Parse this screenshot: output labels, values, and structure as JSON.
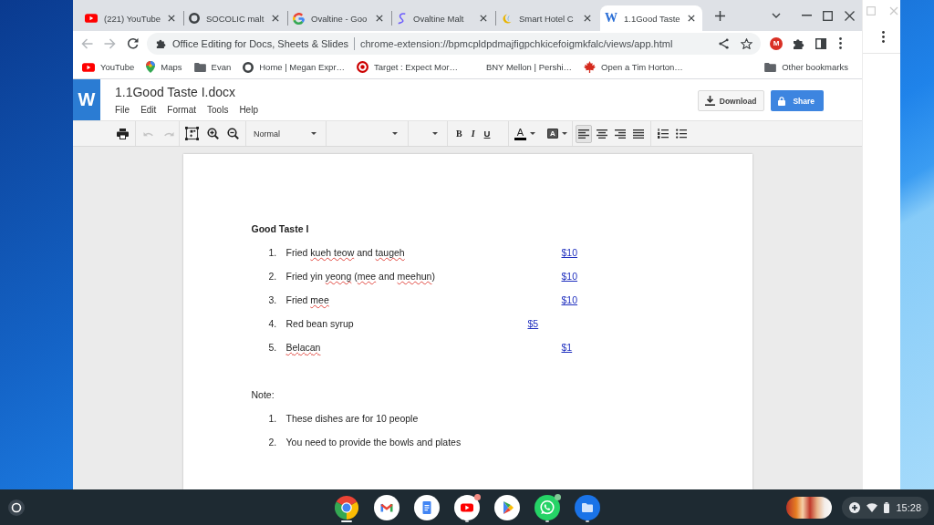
{
  "browser": {
    "tabs": [
      {
        "kind": "video",
        "title": "(221) YouTube",
        "selected": false
      },
      {
        "kind": "ring",
        "title": "SOCOLIC malt",
        "selected": false
      },
      {
        "kind": "g",
        "title": "Ovaltine - Goo",
        "selected": false
      },
      {
        "kind": "script",
        "title": "Ovaltine Malt",
        "selected": false
      },
      {
        "kind": "crescent",
        "title": "Smart Hotel C",
        "selected": false
      },
      {
        "kind": "letter",
        "letter": "W",
        "title": "1.1Good Taste",
        "selected": true
      }
    ],
    "navigation": [
      {
        "kind": "back",
        "disabled": true
      },
      {
        "kind": "forward",
        "disabled": true
      }
    ],
    "omnibox": {
      "site": "Office Editing for Docs, Sheets & Slides",
      "url": "chrome-extension://bpmcpldpdmajfigpchkicefoigmkfalc/views/app.html"
    },
    "extension_badge": "M",
    "bookmarks": [
      {
        "kind": "video",
        "label": "YouTube"
      },
      {
        "kind": "pin",
        "label": "Maps"
      },
      {
        "kind": "folder",
        "label": "Evan"
      },
      {
        "kind": "ring",
        "label": "Home | Megan Expr…"
      },
      {
        "kind": "target",
        "label": "Target : Expect Mor…"
      },
      {
        "kind": "blank",
        "label": "BNY Mellon | Pershi…"
      },
      {
        "kind": "leaf",
        "label": "Open a Tim Horton…"
      }
    ],
    "other_bookmarks": "Other bookmarks"
  },
  "app": {
    "logo": "W",
    "file_name": "1.1Good Taste I.docx",
    "menu": [
      "File",
      "Edit",
      "Format",
      "Tools",
      "Help"
    ],
    "download": "Download",
    "share": "Share",
    "toolbar": {
      "history": [
        {
          "kind": "undo",
          "disabled": true
        },
        {
          "kind": "redo",
          "disabled": true
        }
      ],
      "style": "Normal",
      "format": [
        {
          "kind": "bold",
          "label": "B"
        },
        {
          "kind": "italic",
          "label": "I"
        },
        {
          "kind": "underline",
          "label": "U"
        }
      ],
      "text_color": {
        "label": "A",
        "color": "#000000"
      },
      "highlight": {
        "label": "A"
      },
      "alignment": [
        {
          "kind": "left",
          "selected": true
        },
        {
          "kind": "center",
          "selected": false
        },
        {
          "kind": "right",
          "selected": false
        },
        {
          "kind": "justify",
          "selected": false
        }
      ]
    },
    "document": {
      "title": "Good Taste I",
      "items": [
        {
          "kind": "far",
          "number": "1.",
          "parts": [
            {
              "text": "Fried ",
              "misspelled": false
            },
            {
              "text": "kueh teow",
              "misspelled": true
            },
            {
              "text": " and ",
              "misspelled": false
            },
            {
              "text": "taugeh",
              "misspelled": true
            }
          ],
          "price": "$10"
        },
        {
          "kind": "far",
          "number": "2.",
          "parts": [
            {
              "text": "Fried yin ",
              "misspelled": false
            },
            {
              "text": "yeong",
              "misspelled": true
            },
            {
              "text": " (",
              "misspelled": false
            },
            {
              "text": "mee",
              "misspelled": true
            },
            {
              "text": " and ",
              "misspelled": false
            },
            {
              "text": "meehun",
              "misspelled": true
            },
            {
              "text": ")",
              "misspelled": false
            }
          ],
          "price": "$10"
        },
        {
          "kind": "far",
          "number": "3.",
          "parts": [
            {
              "text": "Fried ",
              "misspelled": false
            },
            {
              "text": "mee",
              "misspelled": true
            }
          ],
          "price": "$10"
        },
        {
          "kind": "near",
          "number": "4.",
          "parts": [
            {
              "text": "Red bean syrup",
              "misspelled": false
            }
          ],
          "price": "$5"
        },
        {
          "kind": "far",
          "number": "5.",
          "parts": [
            {
              "text": "Belacan",
              "misspelled": true
            }
          ],
          "price": "$1"
        }
      ],
      "note_label": "Note:",
      "notes": [
        {
          "number": "1.",
          "text": "These dishes are for 10 people"
        },
        {
          "number": "2.",
          "text": "You need to provide the bowls and plates"
        }
      ]
    }
  },
  "taskbar": {
    "apps": [
      {
        "kind": "browser",
        "running": true,
        "active": true,
        "notification": false
      },
      {
        "kind": "mail",
        "running": false,
        "active": false,
        "notification": false
      },
      {
        "kind": "docs",
        "running": false,
        "active": false,
        "notification": false
      },
      {
        "kind": "video",
        "running": true,
        "active": false,
        "notification": true
      },
      {
        "kind": "store",
        "running": false,
        "active": false,
        "notification": false
      },
      {
        "kind": "chat",
        "running": true,
        "active": false,
        "notification": true
      },
      {
        "kind": "files",
        "running": true,
        "active": false,
        "notification": false
      }
    ],
    "clock": "15:28"
  }
}
